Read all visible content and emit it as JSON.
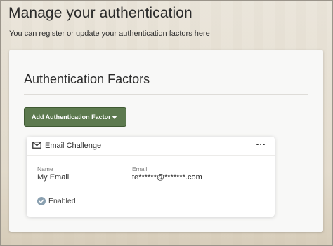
{
  "header": {
    "title": "Manage your authentication",
    "subtitle": "You can register or update your authentication factors here"
  },
  "panel": {
    "section_title": "Authentication Factors",
    "add_button_label": "Add Authentication Factor"
  },
  "factor_card": {
    "title": "Email Challenge",
    "icon": "mail-icon",
    "fields": [
      {
        "label": "Name",
        "value": "My Email"
      },
      {
        "label": "Email",
        "value": "te******@*******.com"
      }
    ],
    "status": "Enabled",
    "status_icon": "check-circle-icon"
  },
  "colors": {
    "button_green": "#5d7a4f",
    "status_icon": "#8aa0b0"
  }
}
